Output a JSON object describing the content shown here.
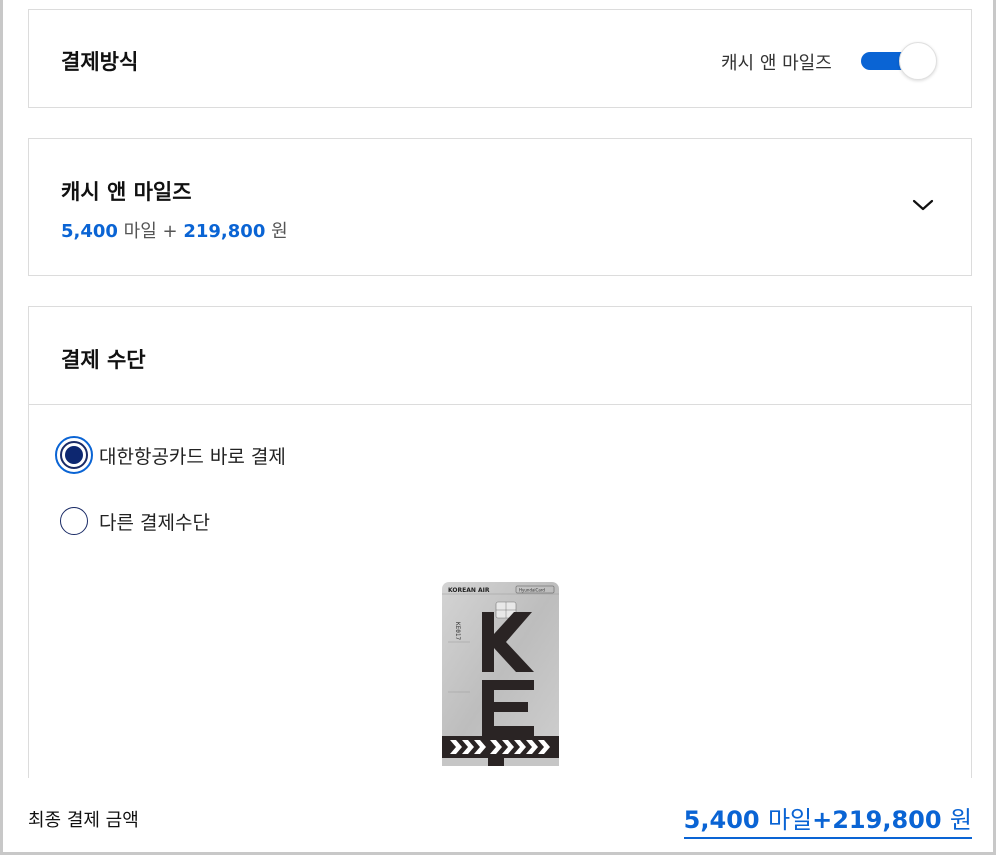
{
  "payment_method": {
    "title": "결제방식",
    "toggle_label": "캐시 앤 마일즈",
    "toggle_on": true
  },
  "cash_miles": {
    "title": "캐시 앤 마일즈",
    "miles_value": "5,400",
    "miles_unit": "마일",
    "plus": "+",
    "cash_value": "219,800",
    "cash_unit": "원"
  },
  "payment_means": {
    "title": "결제 수단",
    "options": [
      {
        "label": "대한항공카드 바로 결제",
        "selected": true
      },
      {
        "label": "다른 결제수단",
        "selected": false
      }
    ],
    "card": {
      "brand_text": "KOREAN AIR",
      "issuer_text": "HyundaiCard",
      "code_text": "KE017"
    }
  },
  "footer": {
    "label": "최종 결제 금액",
    "total_miles": "5,400",
    "total_miles_unit": "마일",
    "plus": "+",
    "total_cash": "219,800",
    "total_cash_unit": "원"
  },
  "colors": {
    "accent": "#0a64d4",
    "radio_dark": "#0d2770",
    "border": "#dcdcdc"
  },
  "icons": {
    "chevron": "chevron-down-icon",
    "chip": "card-chip-icon"
  }
}
